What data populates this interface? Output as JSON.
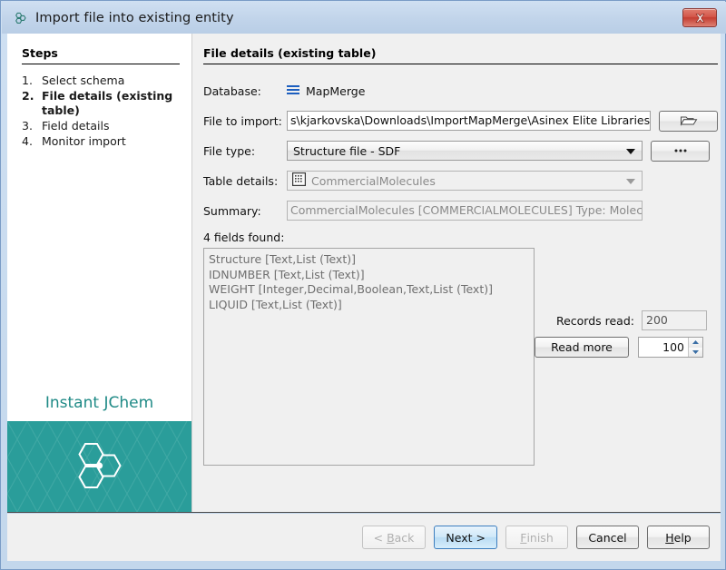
{
  "window": {
    "title": "Import file into existing entity",
    "title_icon": "molecule-icon",
    "close_label": "×"
  },
  "steps": {
    "heading": "Steps",
    "items": [
      {
        "num": "1.",
        "label": "Select schema",
        "current": false
      },
      {
        "num": "2.",
        "label": "File details (existing table)",
        "current": true
      },
      {
        "num": "3.",
        "label": "Field details",
        "current": false
      },
      {
        "num": "4.",
        "label": "Monitor import",
        "current": false
      }
    ]
  },
  "brand": {
    "name": "Instant JChem",
    "logo_icon": "molecule-logo-icon",
    "panel_color": "#2a9d9a",
    "text_color": "#1f8a86"
  },
  "main": {
    "page_title": "File details (existing table)",
    "fields": {
      "database": {
        "label": "Database:",
        "icon": "database-stack-icon",
        "icon_color": "#1d5fbf",
        "value": "MapMerge"
      },
      "file_to_import": {
        "label": "File to import:",
        "value": "s\\kjarkovska\\Downloads\\ImportMapMerge\\Asinex Elite Libraries.sdf",
        "browse_icon": "folder-open-icon"
      },
      "file_type": {
        "label": "File type:",
        "value": "Structure file - SDF",
        "more_label": "•••",
        "more_icon": "ellipsis-icon"
      },
      "table_details": {
        "label": "Table details:",
        "icon": "table-grid-icon",
        "value": "CommercialMolecules"
      },
      "summary": {
        "label": "Summary:",
        "value": "CommercialMolecules [COMMERCIALMOLECULES] Type: Molecules"
      }
    },
    "fields_found": {
      "label": "4 fields found:",
      "items": [
        "Structure [Text,List (Text)]",
        "IDNUMBER [Text,List (Text)]",
        "WEIGHT [Integer,Decimal,Boolean,Text,List (Text)]",
        "LIQUID [Text,List (Text)]"
      ]
    },
    "records": {
      "read_label": "Records read:",
      "read_value": "200",
      "read_more_label": "Read more",
      "spinner_value": "100"
    }
  },
  "footer": {
    "buttons": [
      {
        "name": "back",
        "text": "< Back",
        "state": "disabled"
      },
      {
        "name": "next",
        "text": "Next >",
        "state": "default"
      },
      {
        "name": "finish",
        "text": "Finish",
        "state": "disabled"
      },
      {
        "name": "cancel",
        "text": "Cancel",
        "state": "normal"
      },
      {
        "name": "help",
        "text": "Help",
        "state": "normal"
      }
    ]
  }
}
